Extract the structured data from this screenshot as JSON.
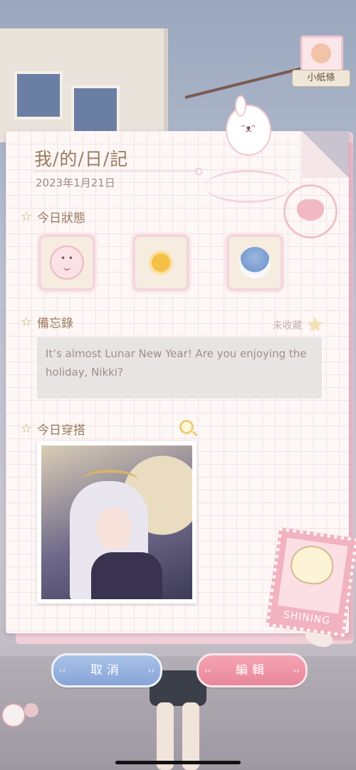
{
  "note_tag": {
    "label": "小紙條"
  },
  "diary": {
    "title": "我/的/日/記",
    "date": "2023年1月21日",
    "status_section": {
      "label": "今日狀態",
      "items": [
        "smile-face-icon",
        "sunny-icon",
        "snow-scene-icon"
      ]
    },
    "memo_section": {
      "label": "備忘錄",
      "favorite_label": "未收藏",
      "text": "It’s almost Lunar New Year! Are you enjoying the holiday, Nikki?"
    },
    "outfit_section": {
      "label": "今日穿搭"
    },
    "stamp_text": "SHINING"
  },
  "buttons": {
    "cancel": "取消",
    "edit": "編輯"
  }
}
